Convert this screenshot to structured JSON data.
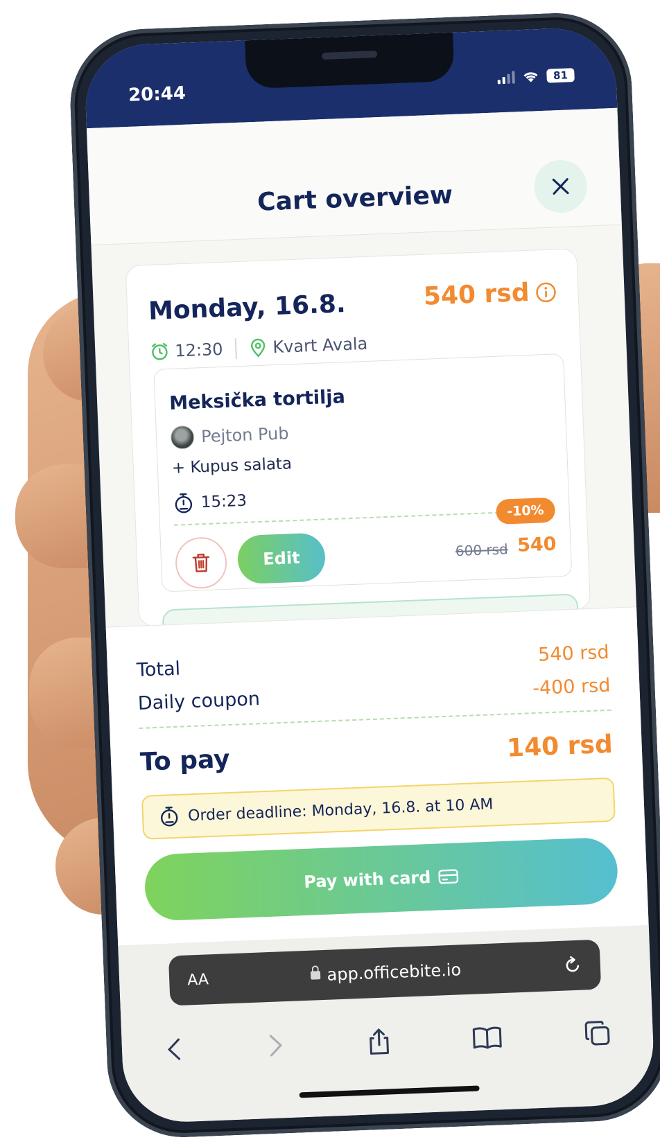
{
  "status_bar": {
    "time": "20:44",
    "battery": "81"
  },
  "header": {
    "title": "Cart overview"
  },
  "day": {
    "title": "Monday, 16.8.",
    "total": "540 rsd",
    "time": "12:30",
    "location": "Kvart Avala"
  },
  "item": {
    "name": "Meksička tortilja",
    "restaurant": "Pejton Pub",
    "addon": "+ Kupus salata",
    "prep_time": "15:23",
    "discount_badge": "-10%",
    "old_price": "600 rsd",
    "new_price": "540",
    "edit_label": "Edit"
  },
  "summary": {
    "total_label": "Total",
    "total_value": "540 rsd",
    "coupon_label": "Daily coupon",
    "coupon_value": "-400 rsd",
    "to_pay_label": "To pay",
    "to_pay_value": "140 rsd",
    "deadline_text": "Order deadline: Monday,  16.8. at 10 AM",
    "pay_label": "Pay  with card"
  },
  "browser": {
    "aa_label": "AA",
    "url": "app.officebite.io"
  },
  "colors": {
    "navy": "#14255a",
    "orange": "#f28a30",
    "green": "#7ccf62",
    "teal": "#57bfc9",
    "status_bar": "#1a2f6b"
  }
}
